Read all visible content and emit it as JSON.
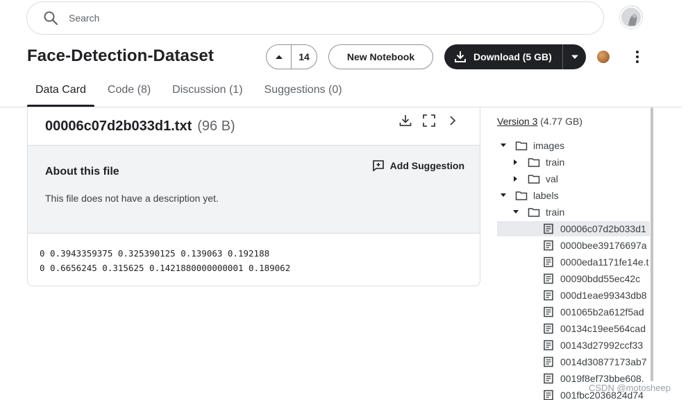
{
  "search": {
    "placeholder": "Search"
  },
  "header": {
    "title": "Face-Detection-Dataset",
    "upvote_count": "14",
    "new_notebook_label": "New Notebook",
    "download_label": "Download (5 GB)"
  },
  "tabs": [
    {
      "label": "Data Card",
      "active": true
    },
    {
      "label": "Code (8)",
      "active": false
    },
    {
      "label": "Discussion (1)",
      "active": false
    },
    {
      "label": "Suggestions (0)",
      "active": false
    }
  ],
  "file": {
    "name": "00006c07d2b033d1.txt",
    "size": "(96 B)",
    "about_title": "About this file",
    "add_suggestion_label": "Add Suggestion",
    "description": "This file does not have a description yet.",
    "lines": [
      "0 0.3943359375 0.325390125 0.139063 0.192188",
      "0 0.6656245 0.315625 0.1421880000000001 0.189062"
    ]
  },
  "sidebar": {
    "version_link": "Version 3",
    "version_size": "(4.77 GB)",
    "tree": [
      {
        "label": "images",
        "type": "folder",
        "expanded": true
      },
      {
        "label": "train",
        "type": "folder",
        "expanded": false
      },
      {
        "label": "val",
        "type": "folder",
        "expanded": false
      },
      {
        "label": "labels",
        "type": "folder",
        "expanded": true
      },
      {
        "label": "train",
        "type": "folder",
        "expanded": true
      },
      {
        "label": "00006c07d2b033d1",
        "type": "file",
        "selected": true
      },
      {
        "label": "0000bee39176697a",
        "type": "file"
      },
      {
        "label": "0000eda1171fe14e.t",
        "type": "file"
      },
      {
        "label": "00090bdd55ec42c",
        "type": "file"
      },
      {
        "label": "000d1eae99343db8",
        "type": "file"
      },
      {
        "label": "001065b2a612f5ad",
        "type": "file"
      },
      {
        "label": "00134c19ee564cad",
        "type": "file"
      },
      {
        "label": "00143d27992ccf33",
        "type": "file"
      },
      {
        "label": "0014d30877173ab7",
        "type": "file"
      },
      {
        "label": "0019f8ef73bbe608.",
        "type": "file"
      },
      {
        "label": "001fbc2036824d74",
        "type": "file"
      }
    ]
  },
  "watermark": "CSDN @motosheep",
  "colors": {
    "text": "#202124",
    "muted": "#5f6368",
    "border": "#dadce0",
    "panel": "#f1f3f4",
    "button_dark": "#202124"
  }
}
